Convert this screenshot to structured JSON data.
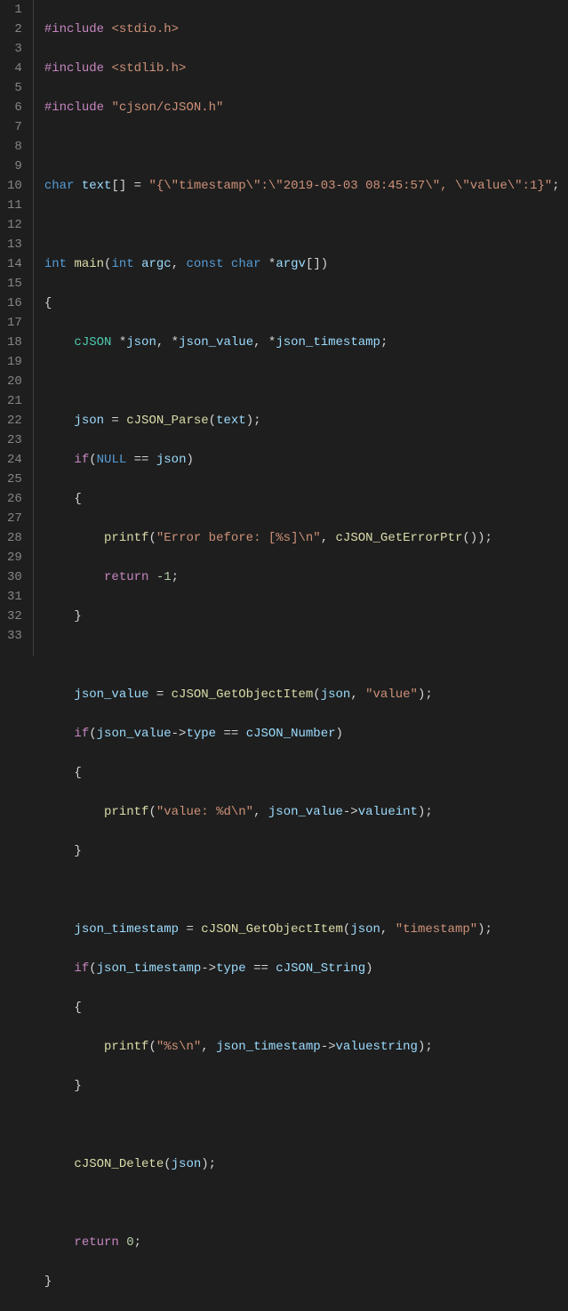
{
  "lines": {
    "count": 33
  },
  "code": {
    "l1": {
      "include": "#include",
      "hdr": "<stdio.h>"
    },
    "l2": {
      "include": "#include",
      "hdr": "<stdlib.h>"
    },
    "l3": {
      "include": "#include",
      "hdr": "\"cjson/cJSON.h\""
    },
    "l5": {
      "type": "char",
      "var": "text",
      "brackets": "[]",
      "eq": " = ",
      "str": "\"{\\\"timestamp\\\":\\\"2019-03-03 08:45:57\\\", \\\"value\\\":1}\"",
      "semi": ";"
    },
    "l7": {
      "type1": "int",
      "fn": "main",
      "lp": "(",
      "type2": "int",
      "arg1": "argc",
      "c": ", ",
      "type3": "const",
      "type4": "char",
      "star": " *",
      "arg2": "argv",
      "br": "[])"
    },
    "l8": {
      "brace": "{"
    },
    "l9": {
      "type": "cJSON",
      "s1": " *",
      "v1": "json",
      "c1": ", *",
      "v2": "json_value",
      "c2": ", *",
      "v3": "json_timestamp",
      "semi": ";"
    },
    "l11": {
      "v": "json",
      "eq": " = ",
      "fn": "cJSON_Parse",
      "lp": "(",
      "arg": "text",
      "rp": ");"
    },
    "l12": {
      "kw": "if",
      "lp": "(",
      "null": "NULL",
      "eq": " == ",
      "v": "json",
      "rp": ")"
    },
    "l13": {
      "brace": "{"
    },
    "l14": {
      "fn": "printf",
      "lp": "(",
      "str": "\"Error before: [%s]\\n\"",
      "c": ", ",
      "fn2": "cJSON_GetErrorPtr",
      "rp": "());"
    },
    "l15": {
      "kw": "return",
      "sp": " ",
      "num": "-1",
      "semi": ";"
    },
    "l16": {
      "brace": "}"
    },
    "l18": {
      "v": "json_value",
      "eq": " = ",
      "fn": "cJSON_GetObjectItem",
      "lp": "(",
      "a1": "json",
      "c": ", ",
      "str": "\"value\"",
      "rp": ");"
    },
    "l19": {
      "kw": "if",
      "lp": "(",
      "v": "json_value",
      "arrow": "->",
      "m": "type",
      "eq": " == ",
      "c": "cJSON_Number",
      "rp": ")"
    },
    "l20": {
      "brace": "{"
    },
    "l21": {
      "fn": "printf",
      "lp": "(",
      "str": "\"value: %d\\n\"",
      "c": ", ",
      "v": "json_value",
      "arrow": "->",
      "m": "valueint",
      "rp": ");"
    },
    "l22": {
      "brace": "}"
    },
    "l24": {
      "v": "json_timestamp",
      "eq": " = ",
      "fn": "cJSON_GetObjectItem",
      "lp": "(",
      "a1": "json",
      "c": ", ",
      "str": "\"timestamp\"",
      "rp": ");"
    },
    "l25": {
      "kw": "if",
      "lp": "(",
      "v": "json_timestamp",
      "arrow": "->",
      "m": "type",
      "eq": " == ",
      "c": "cJSON_String",
      "rp": ")"
    },
    "l26": {
      "brace": "{"
    },
    "l27": {
      "fn": "printf",
      "lp": "(",
      "str": "\"%s\\n\"",
      "c": ", ",
      "v": "json_timestamp",
      "arrow": "->",
      "m": "valuestring",
      "rp": ");"
    },
    "l28": {
      "brace": "}"
    },
    "l30": {
      "fn": "cJSON_Delete",
      "lp": "(",
      "v": "json",
      "rp": ");"
    },
    "l32": {
      "kw": "return",
      "sp": " ",
      "num": "0",
      "semi": ";"
    },
    "l33": {
      "brace": "}"
    }
  }
}
